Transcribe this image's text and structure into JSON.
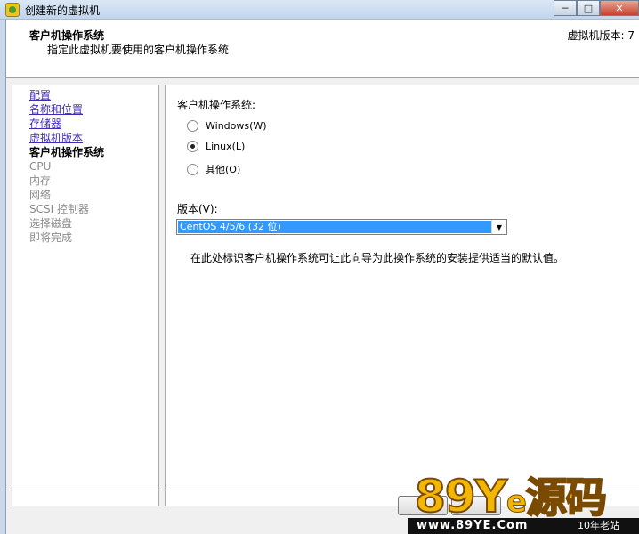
{
  "window": {
    "title": "创建新的虚拟机",
    "min_glyph": "─",
    "max_glyph": "□",
    "close_glyph": "✕"
  },
  "header": {
    "title": "客户机操作系统",
    "subtitle": "指定此虚拟机要使用的客户机操作系统",
    "version": "虚拟机版本: 7"
  },
  "nav": {
    "items": [
      {
        "label": "配置",
        "state": "link"
      },
      {
        "label": "名称和位置",
        "state": "link"
      },
      {
        "label": "存储器",
        "state": "link"
      },
      {
        "label": "虚拟机版本",
        "state": "link"
      },
      {
        "label": "客户机操作系统",
        "state": "current"
      },
      {
        "label": "CPU",
        "state": "disabled"
      },
      {
        "label": "内存",
        "state": "disabled"
      },
      {
        "label": "网络",
        "state": "disabled"
      },
      {
        "label": "SCSI 控制器",
        "state": "disabled"
      },
      {
        "label": "选择磁盘",
        "state": "disabled"
      },
      {
        "label": "即将完成",
        "state": "disabled"
      }
    ]
  },
  "content": {
    "os_label": "客户机操作系统:",
    "options": [
      {
        "label": "Windows(W)",
        "checked": false
      },
      {
        "label": "Linux(L)",
        "checked": true
      },
      {
        "label": "其他(O)",
        "checked": false
      }
    ],
    "version_label": "版本(V):",
    "version_value": "CentOS 4/5/6 (32 位)",
    "description": "在此处标识客户机操作系统可让此向导为此操作系统的安装提供适当的默认值。"
  },
  "watermark": {
    "big_89": "89",
    "big_Y": "Y",
    "big_e": "e",
    "big_cn": "源码",
    "url": "www.89YE.Com",
    "tag": "10年老站"
  },
  "colors": {
    "link": "#3d2bbd",
    "selection": "#3399ff",
    "watermark_gold": "#f2b705"
  }
}
